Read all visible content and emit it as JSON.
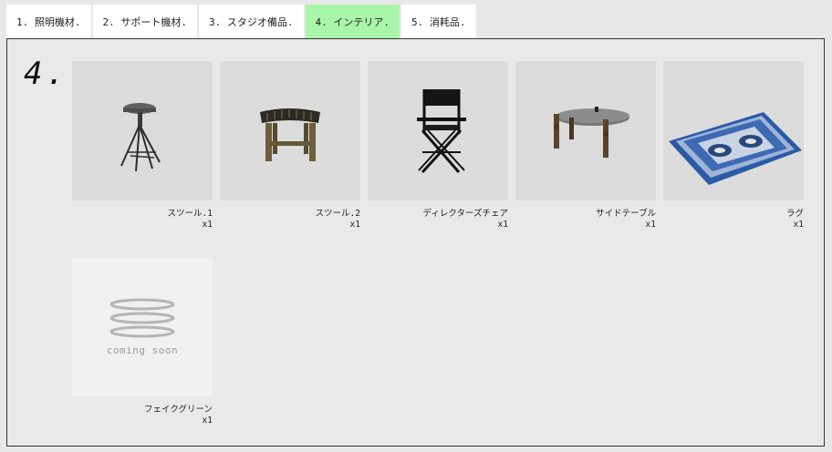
{
  "tabs": [
    {
      "label": "1. 照明機材."
    },
    {
      "label": "2. サポート機材."
    },
    {
      "label": "3. スタジオ備品."
    },
    {
      "label": "4. インテリア."
    },
    {
      "label": "5. 消耗品."
    }
  ],
  "section": {
    "number": "4."
  },
  "items": [
    {
      "name": "スツール.1",
      "qty": "x1",
      "image": "bar-stool"
    },
    {
      "name": "スツール.2",
      "qty": "x1",
      "image": "wooden-stool"
    },
    {
      "name": "ディレクターズチェア",
      "qty": "x1",
      "image": "directors-chair"
    },
    {
      "name": "サイドテーブル",
      "qty": "x1",
      "image": "side-table"
    },
    {
      "name": "ラグ",
      "qty": "x1",
      "image": "rug"
    },
    {
      "name": "フェイクグリーン",
      "qty": "x1",
      "image": "coming-soon",
      "placeholder": "coming soon"
    }
  ],
  "colors": {
    "active_tab": "#a9f5a9",
    "tab": "#ffffff",
    "background": "#e8e8e8"
  }
}
